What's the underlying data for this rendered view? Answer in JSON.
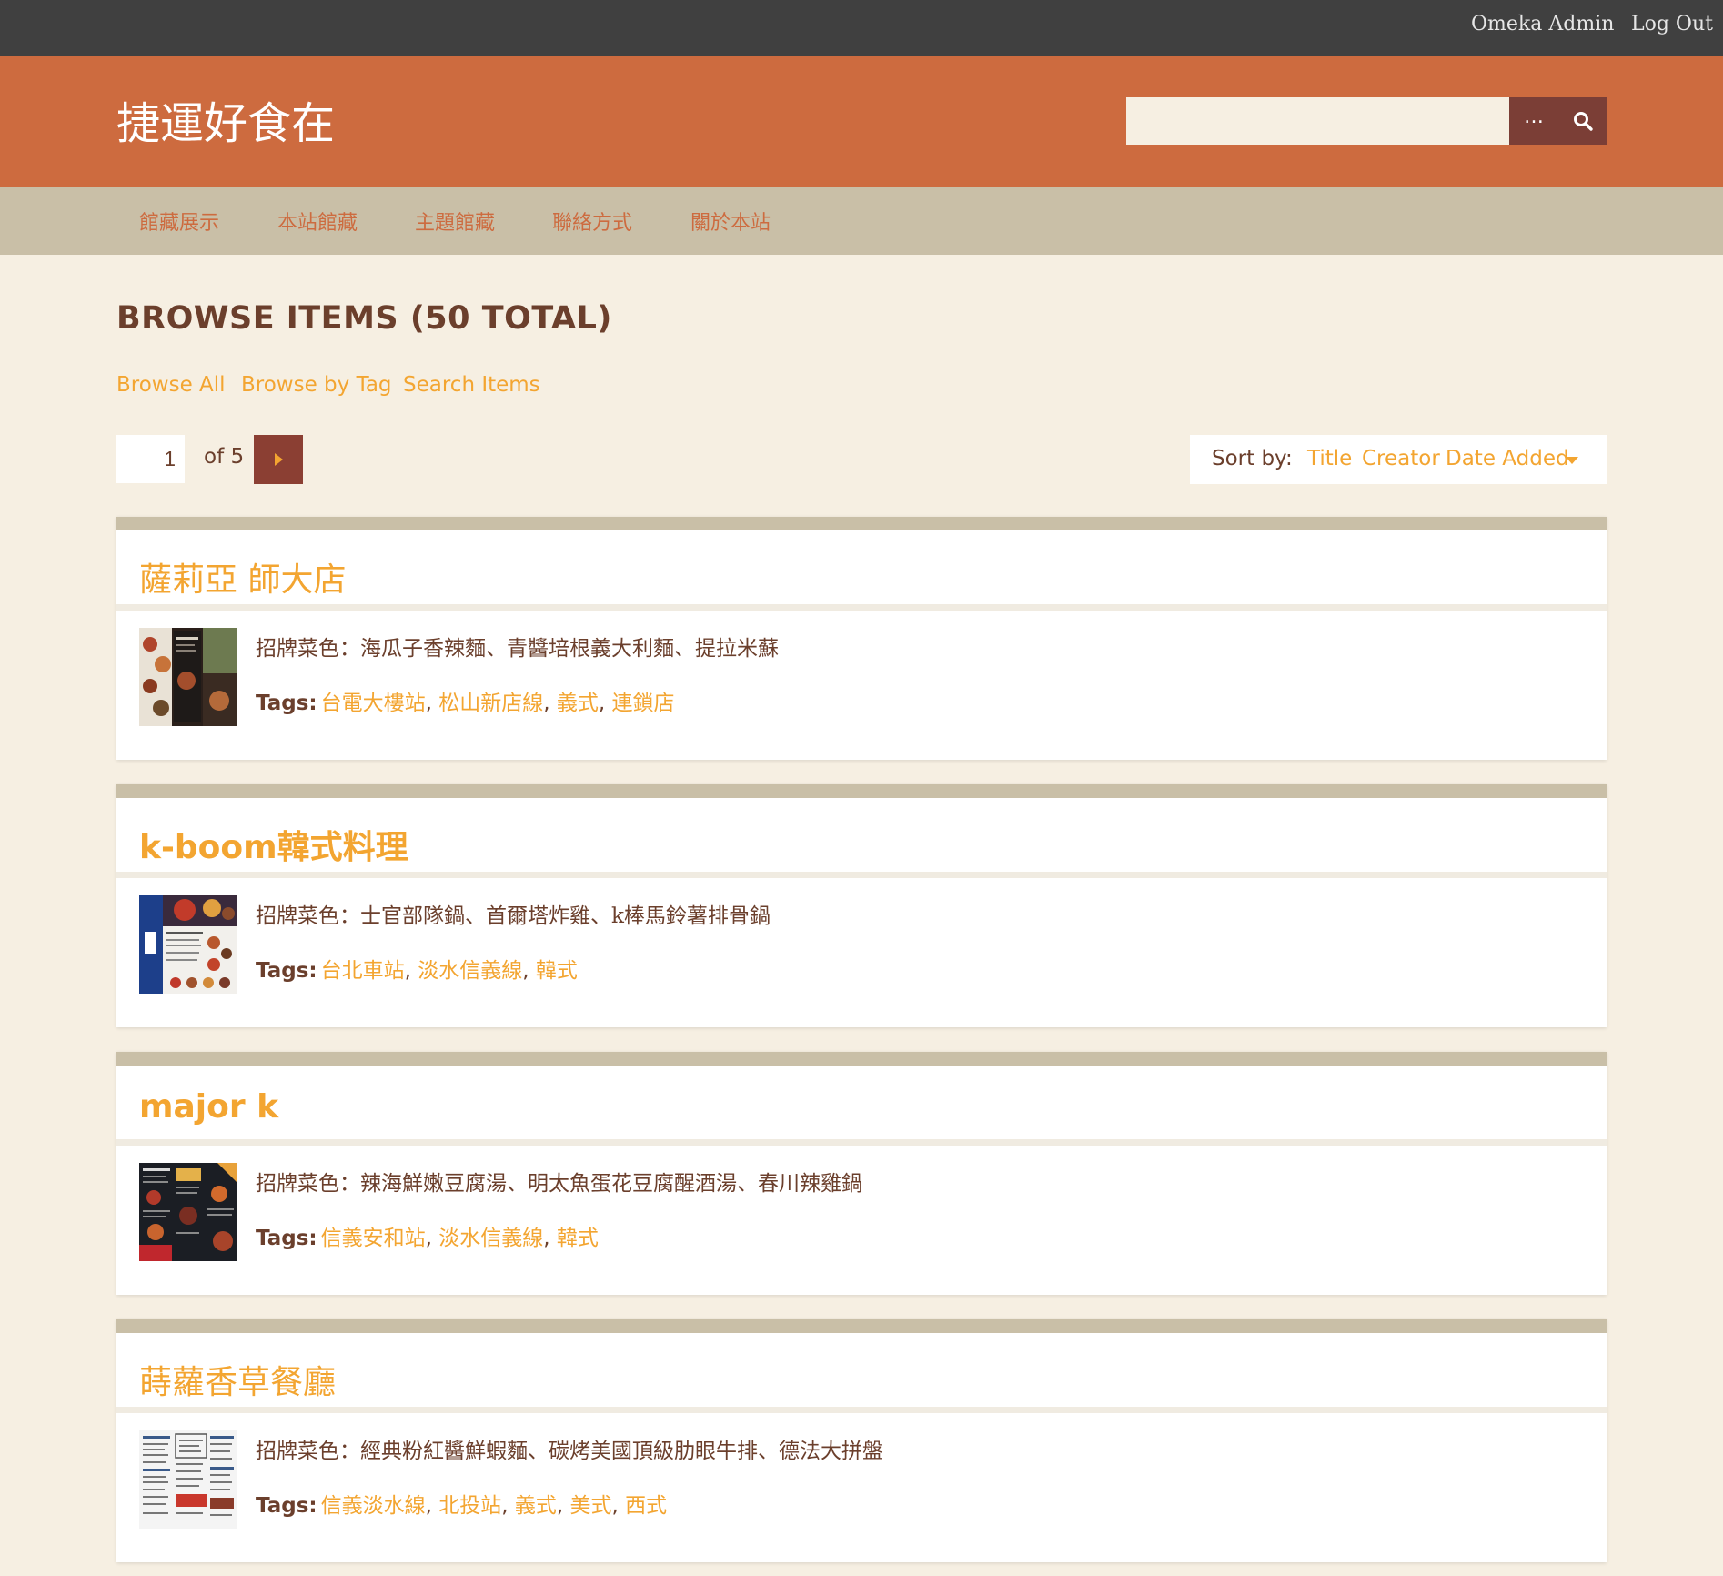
{
  "admin_bar": {
    "admin_link": "Omeka Admin",
    "logout_link": "Log Out"
  },
  "header": {
    "site_title": "捷運好食在",
    "search_placeholder": "",
    "advanced_label": "…",
    "search_icon": "search-icon"
  },
  "nav": {
    "items": [
      "館藏展示",
      "本站館藏",
      "主題館藏",
      "聯絡方式",
      "關於本站"
    ]
  },
  "page": {
    "heading": "BROWSE ITEMS (50 TOTAL)",
    "subnav": [
      "Browse All",
      "Browse by Tag",
      "Search Items"
    ],
    "pagination": {
      "current": "1",
      "of_label": "of 5"
    },
    "sort": {
      "label": "Sort by:",
      "options": [
        "Title",
        "Creator",
        "Date Added"
      ],
      "active": "Date Added",
      "direction": "descending"
    }
  },
  "tags_label": "Tags:",
  "items": [
    {
      "title": "薩莉亞 師大店",
      "description": "招牌菜色：海瓜子香辣麵、青醬培根義大利麵、提拉米蘇",
      "tags": [
        "台電大樓站",
        "松山新店線",
        "義式",
        "連鎖店"
      ]
    },
    {
      "title": "k-boom韓式料理",
      "description": "招牌菜色：士官部隊鍋、首爾塔炸雞、k棒馬鈴薯排骨鍋",
      "tags": [
        "台北車站",
        "淡水信義線",
        "韓式"
      ]
    },
    {
      "title": "major k",
      "description": "招牌菜色：辣海鮮嫩豆腐湯、明太魚蛋花豆腐醒酒湯、春川辣雞鍋",
      "tags": [
        "信義安和站",
        "淡水信義線",
        "韓式"
      ]
    },
    {
      "title": "蒔蘿香草餐廳",
      "description": "招牌菜色：經典粉紅醬鮮蝦麵、碳烤美國頂級肋眼牛排、德法大拼盤",
      "tags": [
        "信義淡水線",
        "北投站",
        "義式",
        "美式",
        "西式"
      ]
    }
  ],
  "colors": {
    "admin_bar": "#404040",
    "header": "#cd6b3f",
    "nav": "#c9bfa7",
    "background": "#f6efe2",
    "accent": "#f3a531",
    "text": "#6b3f2c",
    "button": "#7b3e36"
  }
}
